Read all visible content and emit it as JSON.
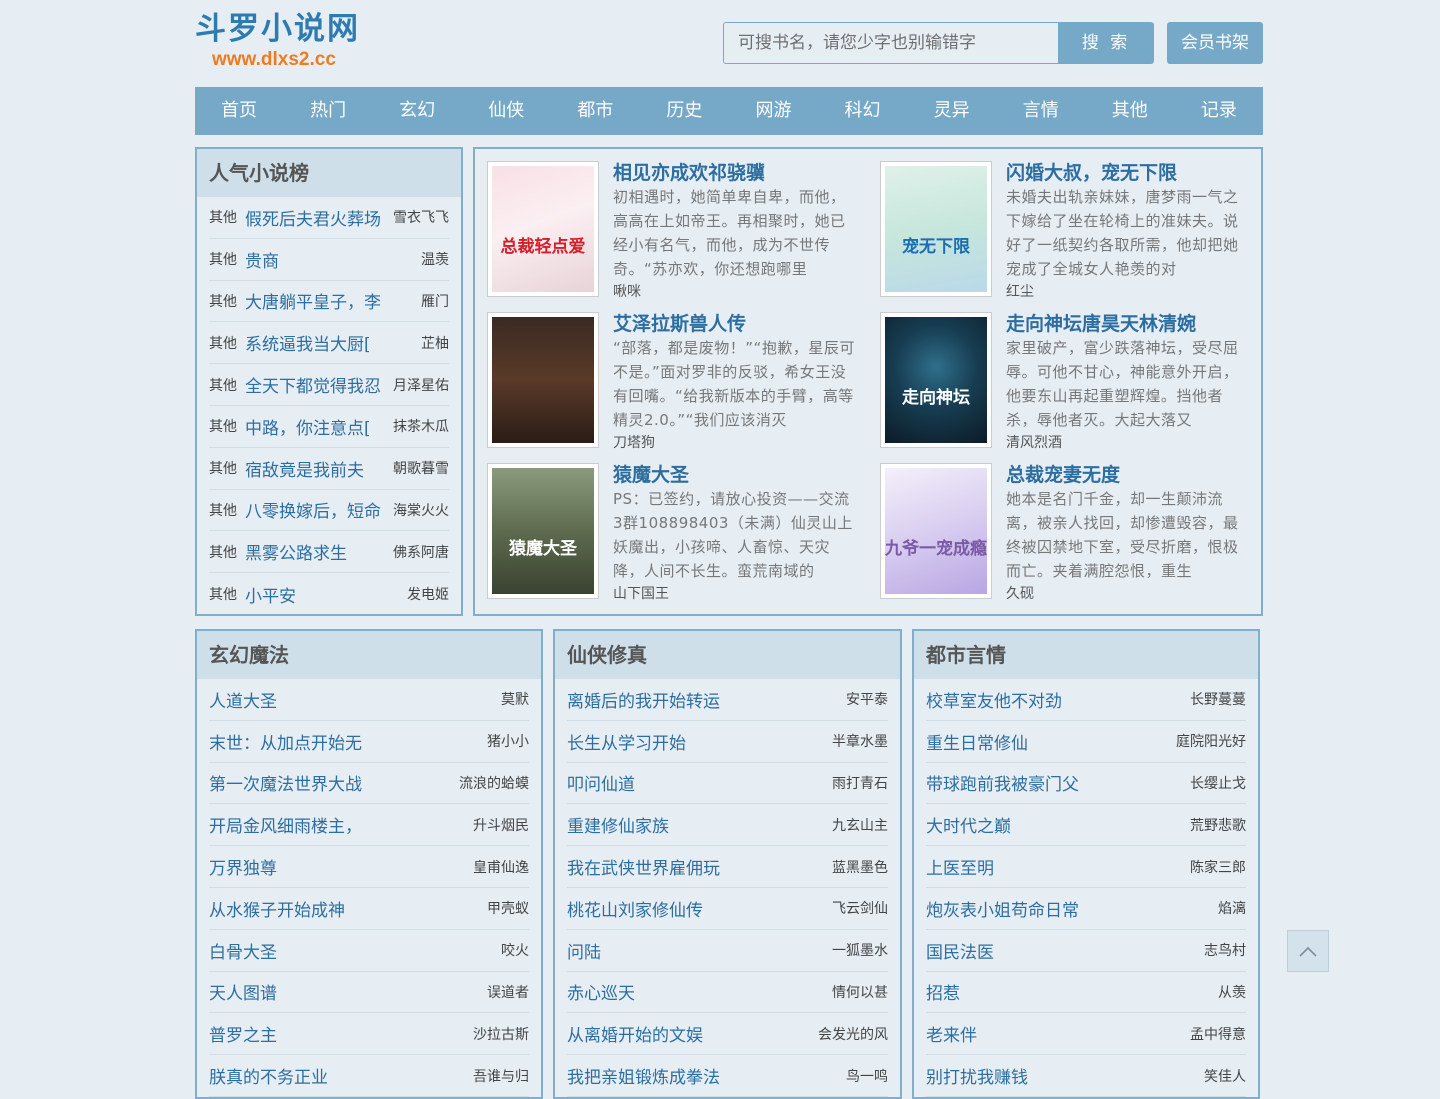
{
  "site": {
    "title": "斗罗小说网",
    "url": "www.dlxs2.cc"
  },
  "search": {
    "placeholder": "可搜书名，请您少字也别输错字",
    "button": "搜 索"
  },
  "member_button": "会员书架",
  "nav": [
    "首页",
    "热门",
    "玄幻",
    "仙侠",
    "都市",
    "历史",
    "网游",
    "科幻",
    "灵异",
    "言情",
    "其他",
    "记录"
  ],
  "popular": {
    "heading": "人气小说榜",
    "items": [
      {
        "category": "其他",
        "title": "假死后夫君火葬场",
        "author": "雪衣飞飞"
      },
      {
        "category": "其他",
        "title": "贵商",
        "author": "温羡"
      },
      {
        "category": "其他",
        "title": "大唐躺平皇子，李",
        "author": "雁门"
      },
      {
        "category": "其他",
        "title": "系统逼我当大厨[",
        "author": "芷柚"
      },
      {
        "category": "其他",
        "title": "全天下都觉得我忍",
        "author": "月泽星佑"
      },
      {
        "category": "其他",
        "title": "中路，你注意点[",
        "author": "抹茶木瓜"
      },
      {
        "category": "其他",
        "title": "宿敌竟是我前夫",
        "author": "朝歌暮雪"
      },
      {
        "category": "其他",
        "title": "八零换嫁后，短命",
        "author": "海棠火火"
      },
      {
        "category": "其他",
        "title": "黑雾公路求生",
        "author": "佛系阿唐"
      },
      {
        "category": "其他",
        "title": "小平安",
        "author": "发电姬"
      }
    ]
  },
  "featured": [
    {
      "title": "相见亦成欢祁骁骥",
      "desc": "初相遇时，她简单卑自卑，而他，高高在上如帝王。再相聚时，她已经小有名气，而他，成为不世传奇。“苏亦欢，你还想跑哪里",
      "author": "啾咪",
      "cover_text": "总裁轻点爱"
    },
    {
      "title": "闪婚大叔，宠无下限",
      "desc": "未婚夫出轨亲妹妹，唐梦雨一气之下嫁给了坐在轮椅上的准妹夫。说好了一纸契约各取所需，他却把她宠成了全城女人艳羡的对",
      "author": "红尘",
      "cover_text": "宠无下限"
    },
    {
      "title": "艾泽拉斯兽人传",
      "desc": "“部落，都是废物！”“抱歉，星辰可不是。”面对罗非的反驳，希女王没有回嘴。“给我新版本的手臂，高等精灵2.0。”“我们应该消灭",
      "author": "刀塔狗",
      "cover_text": ""
    },
    {
      "title": "走向神坛唐昊天林清婉",
      "desc": "家里破产，富少跌落神坛，受尽屈辱。可他不甘心，神能意外开启，他要东山再起重塑辉煌。挡他者杀，辱他者灭。大起大落又",
      "author": "清风烈酒",
      "cover_text": "走向神坛"
    },
    {
      "title": "猿魔大圣",
      "desc": "PS：已签约，请放心投资——交流3群108898403（未满）仙灵山上妖魔出，小孩啼、人畜惊、天灾降，人间不长生。蛮荒南域的",
      "author": "山下国王",
      "cover_text": "猿魔大圣"
    },
    {
      "title": "总裁宠妻无度",
      "desc": "她本是名门千金，却一生颠沛流离，被亲人找回，却惨遭毁容，最终被囚禁地下室，受尽折磨，恨极而亡。夹着满腔怨恨，重生",
      "author": "久砚",
      "cover_text": "九爷一宠成瘾"
    }
  ],
  "categories": [
    {
      "heading": "玄幻魔法",
      "items": [
        {
          "title": "人道大圣",
          "author": "莫默"
        },
        {
          "title": "末世：从加点开始无",
          "author": "猪小小"
        },
        {
          "title": "第一次魔法世界大战",
          "author": "流浪的蛤蟆"
        },
        {
          "title": "开局金风细雨楼主，",
          "author": "升斗烟民"
        },
        {
          "title": "万界独尊",
          "author": "皇甫仙逸"
        },
        {
          "title": "从水猴子开始成神",
          "author": "甲壳蚁"
        },
        {
          "title": "白骨大圣",
          "author": "咬火"
        },
        {
          "title": "天人图谱",
          "author": "误道者"
        },
        {
          "title": "普罗之主",
          "author": "沙拉古斯"
        },
        {
          "title": "朕真的不务正业",
          "author": "吾谁与归"
        }
      ]
    },
    {
      "heading": "仙侠修真",
      "items": [
        {
          "title": "离婚后的我开始转运",
          "author": "安平泰"
        },
        {
          "title": "长生从学习开始",
          "author": "半章水墨"
        },
        {
          "title": "叩问仙道",
          "author": "雨打青石"
        },
        {
          "title": "重建修仙家族",
          "author": "九玄山主"
        },
        {
          "title": "我在武侠世界雇佣玩",
          "author": "蓝黑墨色"
        },
        {
          "title": "桃花山刘家修仙传",
          "author": "飞云剑仙"
        },
        {
          "title": "问陆",
          "author": "一狐墨水"
        },
        {
          "title": "赤心巡天",
          "author": "情何以甚"
        },
        {
          "title": "从离婚开始的文娱",
          "author": "会发光的风"
        },
        {
          "title": "我把亲姐锻炼成拳法",
          "author": "鸟一鸣"
        }
      ]
    },
    {
      "heading": "都市言情",
      "items": [
        {
          "title": "校草室友他不对劲",
          "author": "长野蔓蔓"
        },
        {
          "title": "重生日常修仙",
          "author": "庭院阳光好"
        },
        {
          "title": "带球跑前我被豪门父",
          "author": "长缨止戈"
        },
        {
          "title": "大时代之巅",
          "author": "荒野悲歌"
        },
        {
          "title": "上医至明",
          "author": "陈家三郎"
        },
        {
          "title": "炮灰表小姐苟命日常",
          "author": "焰漓"
        },
        {
          "title": "国民法医",
          "author": "志鸟村"
        },
        {
          "title": "招惹",
          "author": "从羡"
        },
        {
          "title": "老来伴",
          "author": "孟中得意"
        },
        {
          "title": "别打扰我赚钱",
          "author": "笑佳人"
        }
      ]
    }
  ],
  "colors": {
    "background": "#e6eef4",
    "nav": "#76a8c8",
    "link": "#2d6ea0",
    "logo": "#2e7bb0",
    "url": "#f07b1e",
    "box_border": "#80aecb",
    "box_head": "#cfdfea"
  }
}
